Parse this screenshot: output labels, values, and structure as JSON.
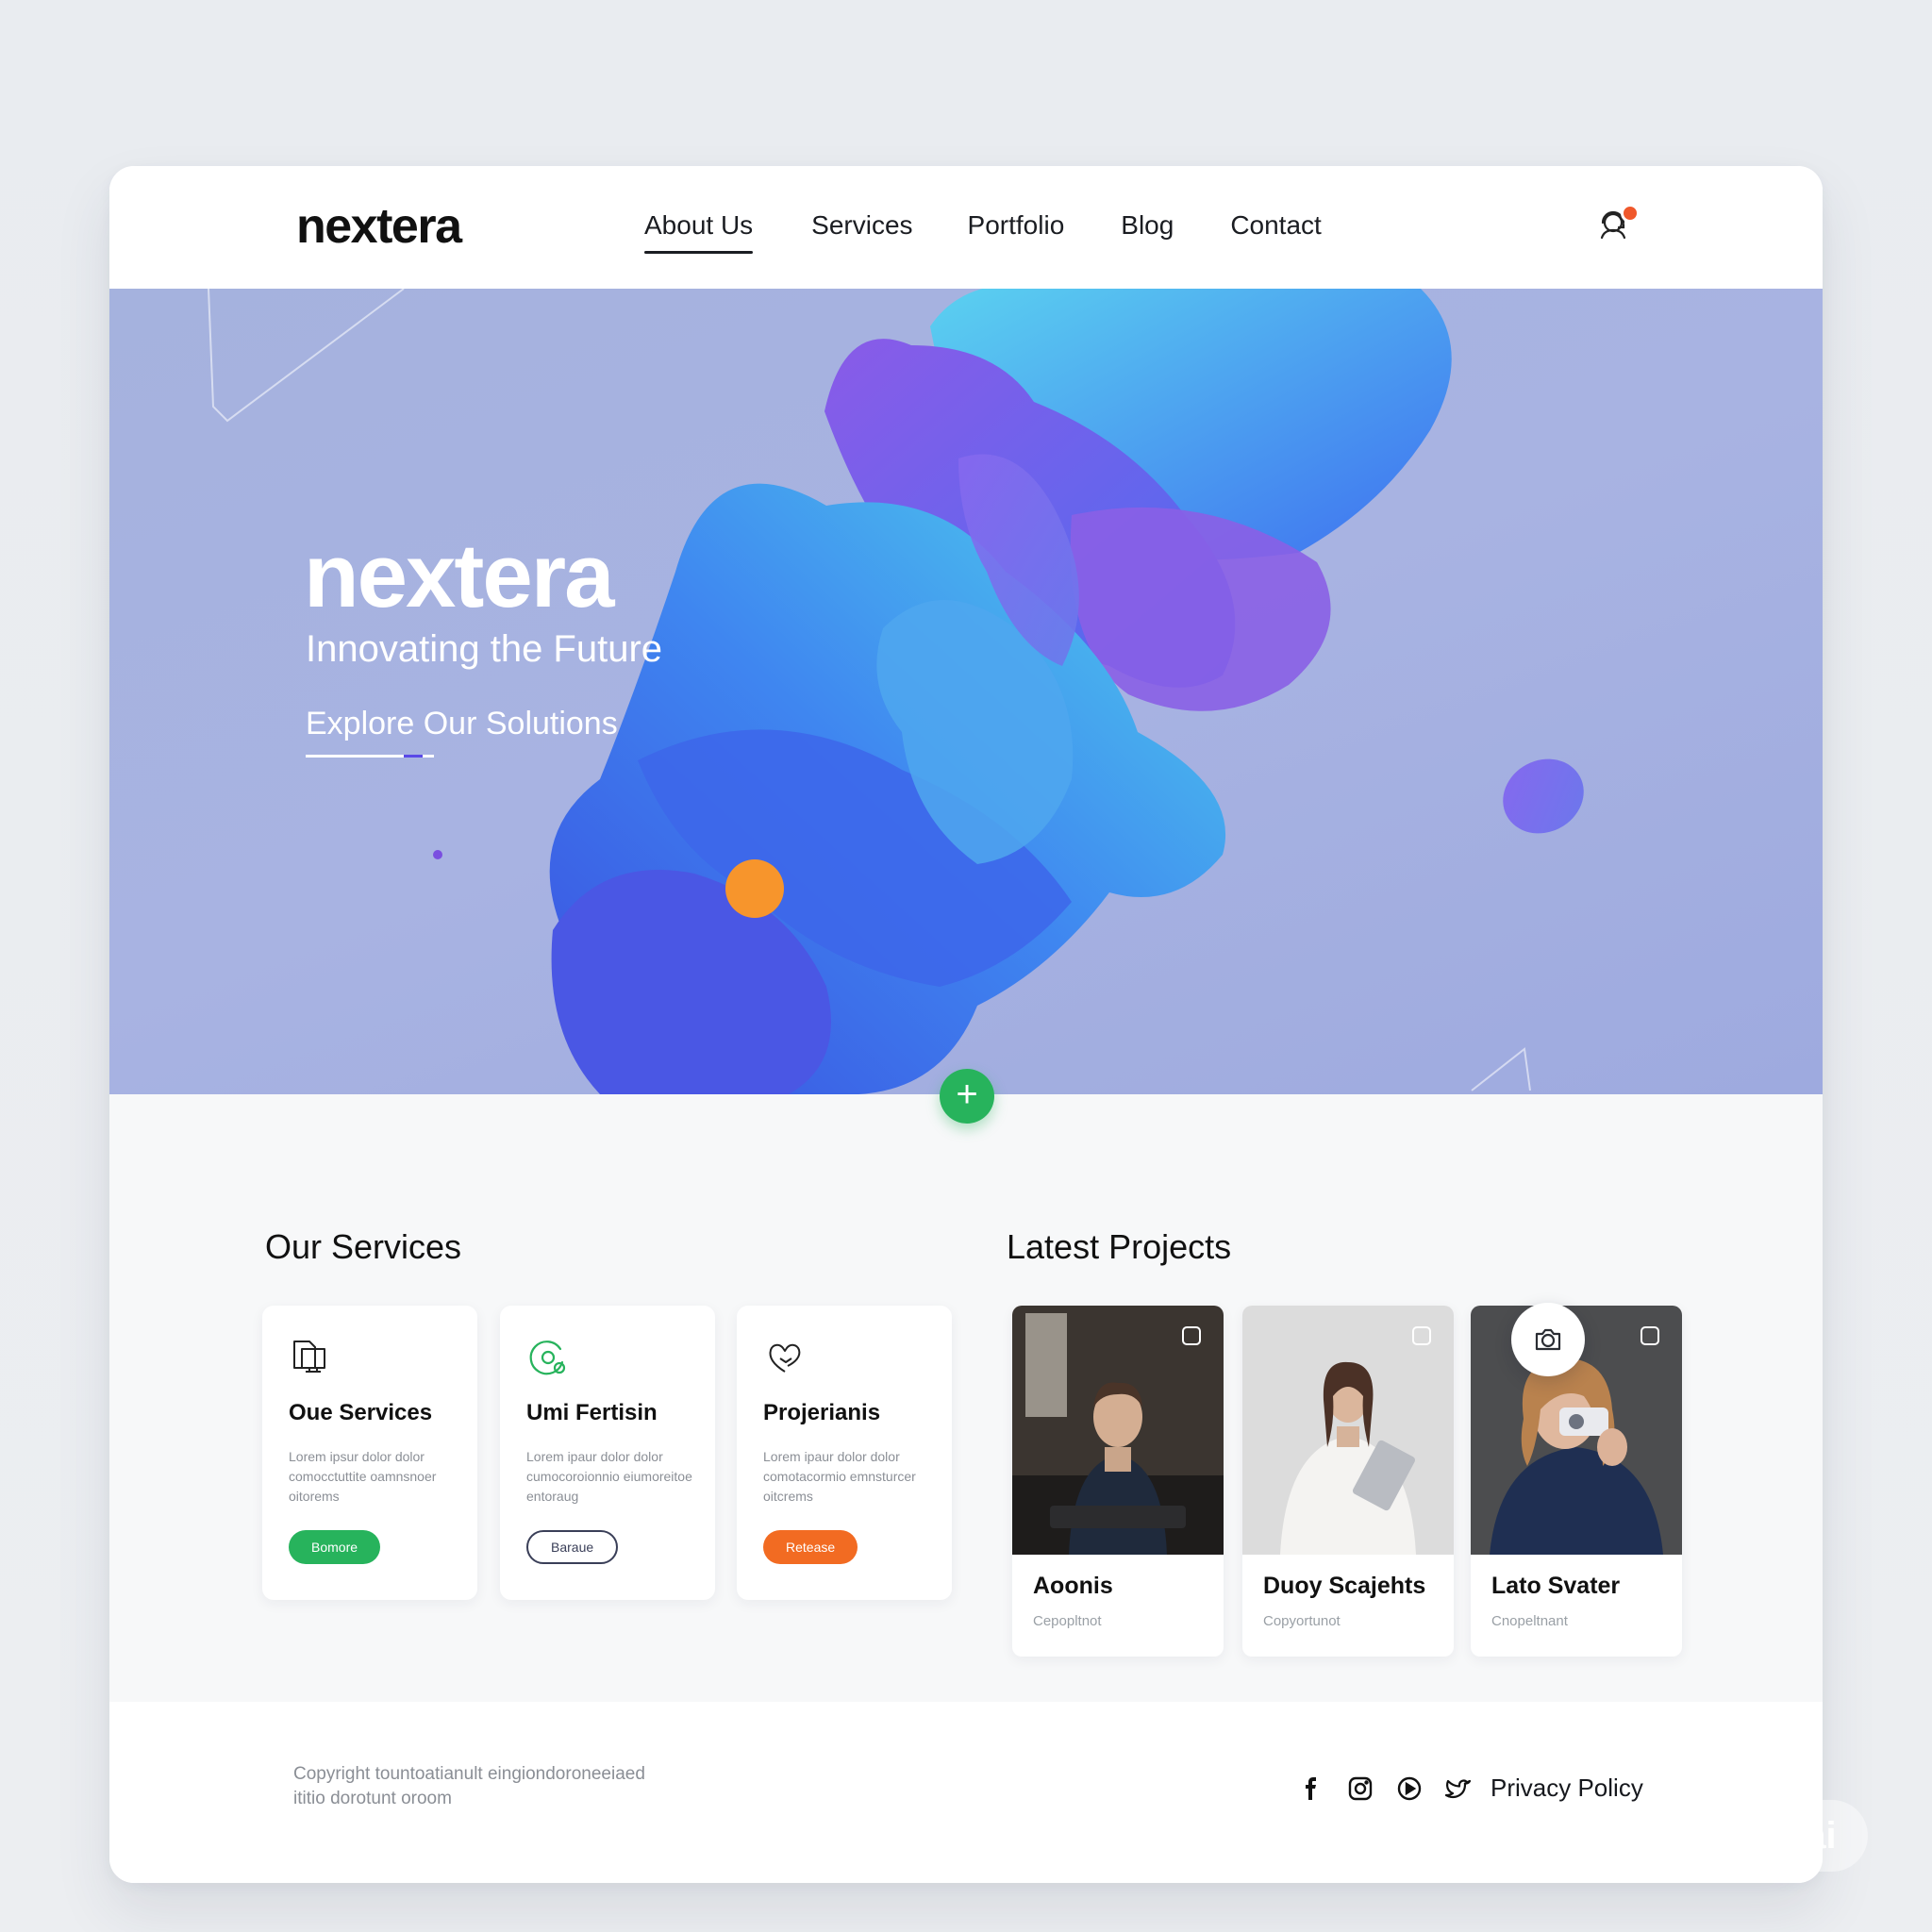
{
  "brand": {
    "name": "nextera"
  },
  "nav": {
    "items": [
      {
        "label": "About Us"
      },
      {
        "label": "Services"
      },
      {
        "label": "Portfolio"
      },
      {
        "label": "Blog"
      },
      {
        "label": "Contact"
      }
    ],
    "active_index": 0
  },
  "header": {
    "icon": "support-agent-icon",
    "notification_color": "#f0582b"
  },
  "hero": {
    "title": "nextera",
    "subtitle": "Innovating the Future",
    "cta": "Explore Our Solutions",
    "plus_button": "+"
  },
  "services": {
    "heading": "Our Services",
    "cards": [
      {
        "title": "Oue Services",
        "description": "Lorem ipsur dolor dolor comocctuttite oamnsnoer oitorems",
        "button": "Bomore",
        "icon": "document-monitor-icon",
        "button_style": "green"
      },
      {
        "title": "Umi Fertisin",
        "description": "Lorem ipaur dolor dolor cumocoroionnio eiumoreitoe entoraug",
        "button": "Baraue",
        "icon": "refresh-target-icon",
        "button_style": "outline"
      },
      {
        "title": "Projerianis",
        "description": "Lorem ipaur dolor dolor comotacormio emnsturcer oitcrems",
        "button": "Retease",
        "icon": "heart-hand-icon",
        "button_style": "orange"
      }
    ]
  },
  "projects": {
    "heading": "Latest Projects",
    "cards": [
      {
        "title": "Aoonis",
        "subtitle": "Cepopltnot",
        "image": "man-with-keyboard-photo"
      },
      {
        "title": "Duoy Scajehts",
        "subtitle": "Copyortunot",
        "image": "woman-with-tablet-photo"
      },
      {
        "title": "Lato Svater",
        "subtitle": "Cnopeltnant",
        "image": "woman-with-camera-photo"
      }
    ],
    "fab_icon": "camera-icon"
  },
  "footer": {
    "copyright_line1": "Copyright tountoatianult eingiondoroneeiaed",
    "copyright_line2": "ititio dorotunt oroom",
    "socials": [
      "facebook-icon",
      "instagram-icon",
      "play-icon",
      "twitter-icon"
    ],
    "privacy": "Privacy Policy"
  },
  "watermark": "ai",
  "colors": {
    "accent_green": "#27b35c",
    "accent_orange": "#f26b22",
    "hero_bg": "#a8b3e2",
    "outline_button": "#3a3f58"
  }
}
